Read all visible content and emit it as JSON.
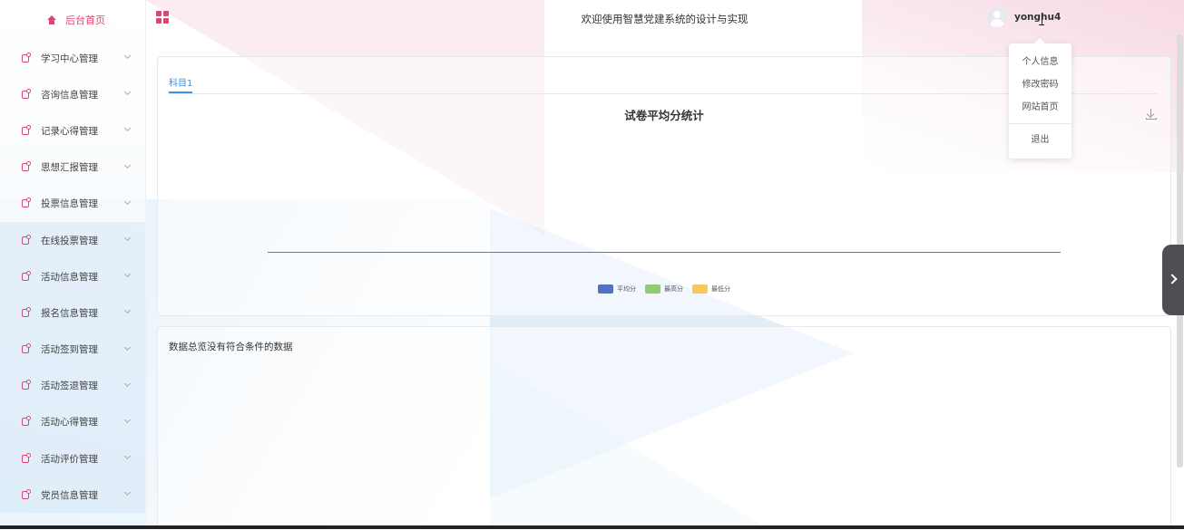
{
  "header": {
    "title": "欢迎使用智慧党建系统的设计与实现",
    "username": "yonghu4"
  },
  "sidebar": {
    "home_label": "后台首页",
    "items": [
      {
        "label": "学习中心管理"
      },
      {
        "label": "咨询信息管理"
      },
      {
        "label": "记录心得管理"
      },
      {
        "label": "思想汇报管理"
      },
      {
        "label": "投票信息管理"
      },
      {
        "label": "在线投票管理"
      },
      {
        "label": "活动信息管理"
      },
      {
        "label": "报名信息管理"
      },
      {
        "label": "活动签到管理"
      },
      {
        "label": "活动签退管理"
      },
      {
        "label": "活动心得管理"
      },
      {
        "label": "活动评价管理"
      },
      {
        "label": "党员信息管理"
      }
    ]
  },
  "user_menu": {
    "items": [
      "个人信息",
      "修改密码",
      "网站首页"
    ],
    "logout": "退出"
  },
  "main": {
    "tab_label": "科目1",
    "empty_table_text": "数据总览没有符合条件的数据"
  },
  "chart_data": {
    "type": "bar",
    "title": "试卷平均分统计",
    "categories": [],
    "series": [
      {
        "name": "平均分",
        "color": "#5470c6",
        "values": []
      },
      {
        "name": "最高分",
        "color": "#91cc75",
        "values": []
      },
      {
        "name": "最低分",
        "color": "#fac858",
        "values": []
      }
    ],
    "legend": "bottom-center"
  },
  "colors": {
    "accent": "#e0456f",
    "tab_active": "#3f8ee8"
  }
}
